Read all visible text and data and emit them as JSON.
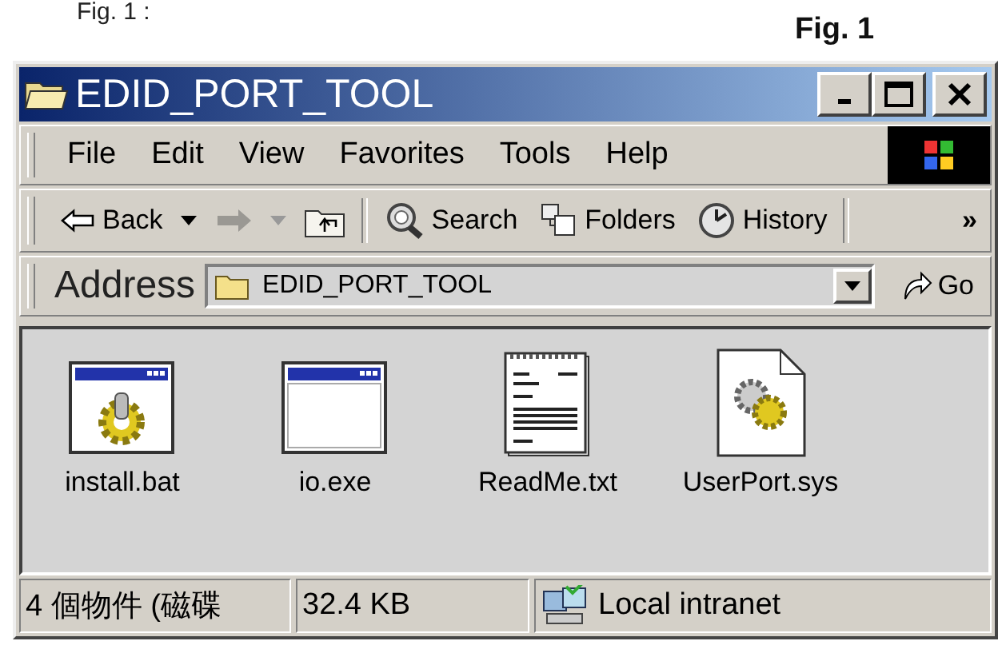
{
  "caption_top": "Fig. 1 :",
  "figure_label": "Fig. 1",
  "window": {
    "title": "EDID_PORT_TOOL"
  },
  "menu": [
    "File",
    "Edit",
    "View",
    "Favorites",
    "Tools",
    "Help"
  ],
  "toolbar": {
    "items": [
      {
        "kind": "back",
        "label": "Back",
        "disabled": false
      },
      {
        "kind": "forward",
        "disabled": true
      },
      {
        "kind": "up",
        "disabled": false
      },
      {
        "kind": "search",
        "label": "Search",
        "disabled": false
      },
      {
        "kind": "folders",
        "label": "Folders",
        "disabled": false
      },
      {
        "kind": "history",
        "label": "History",
        "disabled": false
      }
    ],
    "more": "»"
  },
  "address": {
    "label": "Address",
    "value": "EDID_PORT_TOOL",
    "go": "Go"
  },
  "files": [
    {
      "name": "install.bat",
      "kind": "batch"
    },
    {
      "name": "io.exe",
      "kind": "app"
    },
    {
      "name": "ReadMe.txt",
      "kind": "text"
    },
    {
      "name": "UserPort.sys",
      "kind": "system"
    }
  ],
  "status_bar": {
    "fields": [
      "4 個物件 (磁碟",
      "32.4 KB"
    ],
    "zone": "Local intranet"
  }
}
